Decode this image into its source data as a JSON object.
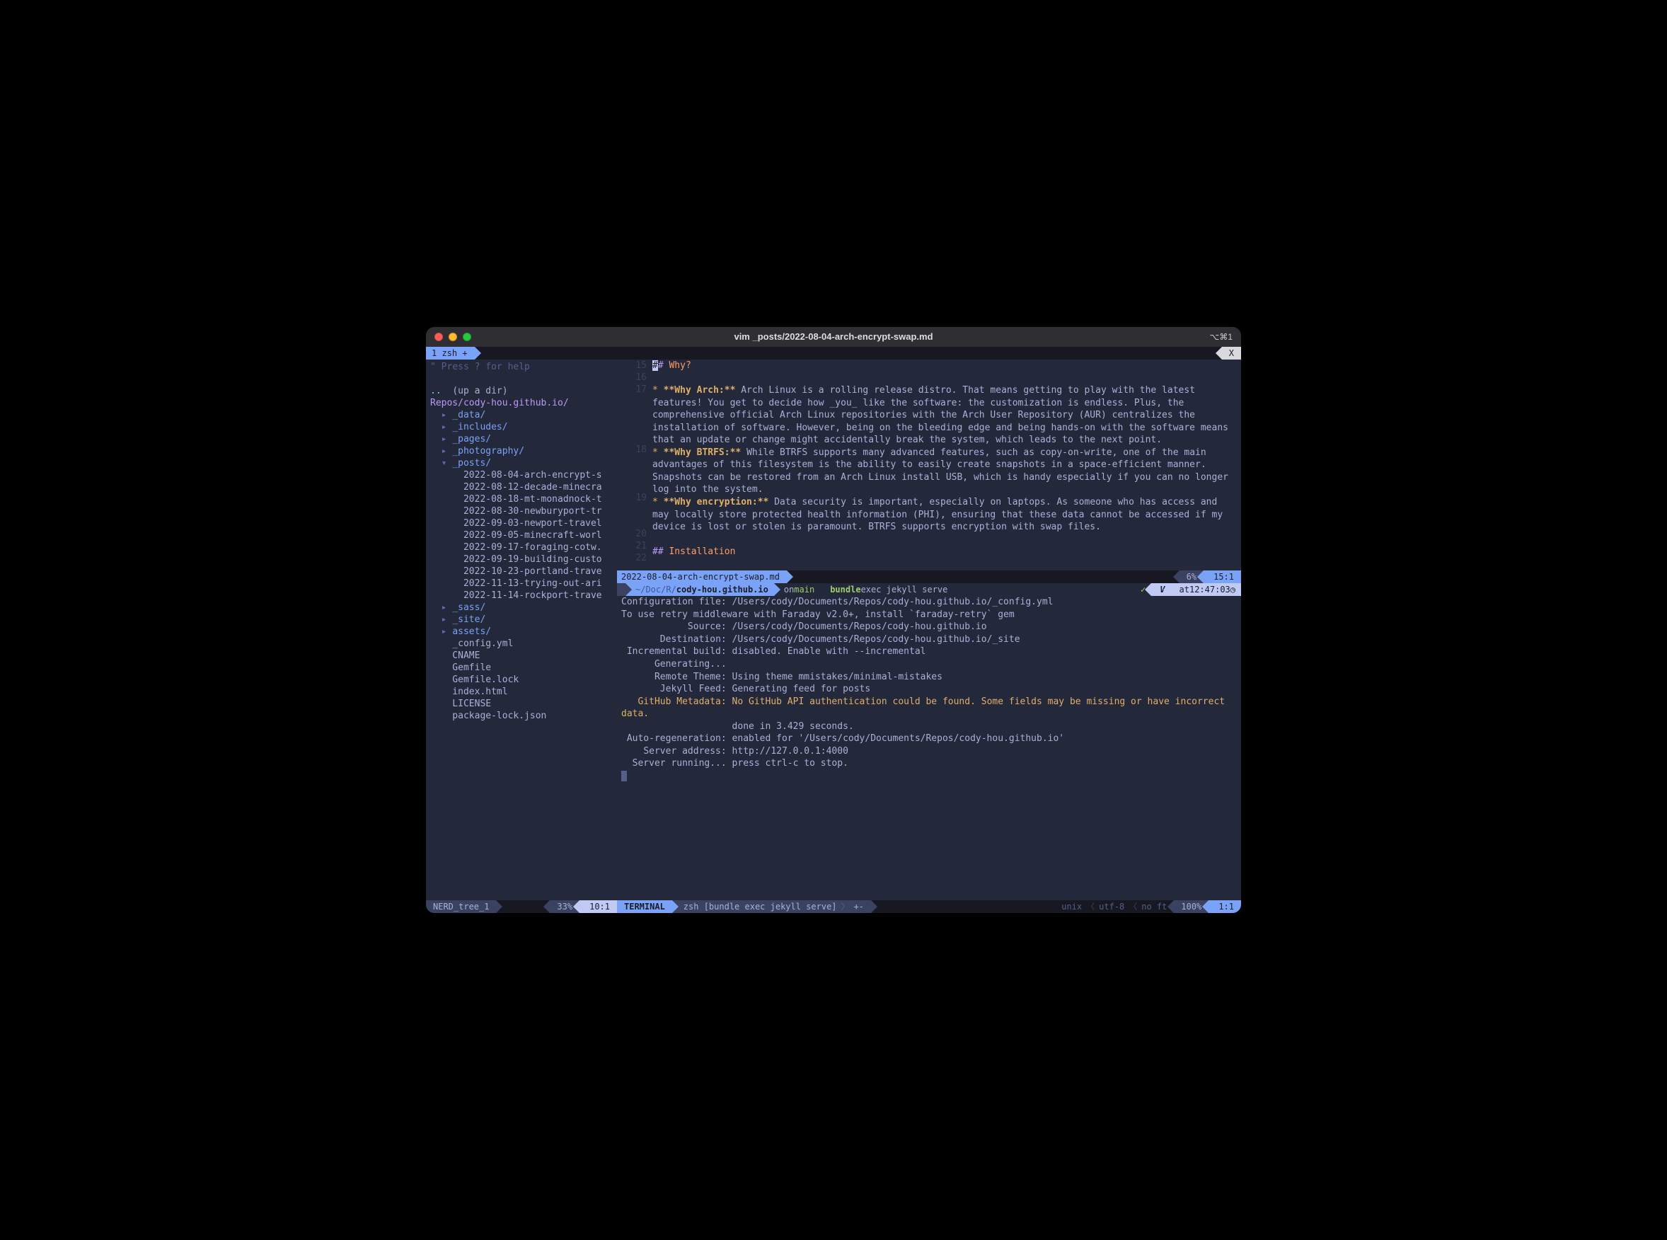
{
  "titlebar": {
    "title": "vim _posts/2022-08-04-arch-encrypt-swap.md",
    "shortcut": "⌥⌘1"
  },
  "tmux_tab": {
    "label": "1 zsh +",
    "close": "X"
  },
  "nerdtree": {
    "help": "\" Press ? for help",
    "up_dotdot": "..",
    "up_label": "(up a dir)",
    "root_marker": "</",
    "root_path": "Repos/cody-hou.github.io/",
    "folders_closed": [
      "_data/",
      "_includes/",
      "_pages/",
      "_photography/"
    ],
    "folder_open": "_posts/",
    "posts": [
      "2022-08-04-arch-encrypt-s",
      "2022-08-12-decade-minecra",
      "2022-08-18-mt-monadnock-t",
      "2022-08-30-newburyport-tr",
      "2022-09-03-newport-travel",
      "2022-09-05-minecraft-worl",
      "2022-09-17-foraging-cotw.",
      "2022-09-19-building-custo",
      "2022-10-23-portland-trave",
      "2022-11-13-trying-out-ari",
      "2022-11-14-rockport-trave"
    ],
    "folders_after": [
      "_sass/",
      "_site/",
      "assets/"
    ],
    "files": [
      "_config.yml",
      "CNAME",
      "Gemfile",
      "Gemfile.lock",
      "index.html",
      "LICENSE",
      "package-lock.json"
    ]
  },
  "editor": {
    "gutter_start": 15,
    "lines": [
      {
        "n": 15,
        "pre": "## ",
        "kw": "Why?"
      },
      {
        "n": 16,
        "text": ""
      },
      {
        "n": 17,
        "star": "*",
        "bold": " **Why Arch:** ",
        "text": "Arch Linux is a rolling release distro. That means getting to play with the latest features! You get to decide how _you_ like the software: the customization is endless. Plus, the comprehensive official Arch Linux repositories with the Arch User Repository (AUR) centralizes the installation of software. However, being on the bleeding edge and being hands-on with the software means that an update or change might accidentally break the system, which leads to the next point."
      },
      {
        "n": 18,
        "star": "*",
        "bold": " **Why BTRFS:** ",
        "text": "While BTRFS supports many advanced features, such as copy-on-write, one of the main advantages of this filesystem is the ability to easily create snapshots in a space-efficient manner. Snapshots can be restored from an Arch Linux install USB, which is handy especially if you can no longer log into the system."
      },
      {
        "n": 19,
        "star": "*",
        "bold": " **Why encryption:** ",
        "text": "Data security is important, especially on laptops. As someone who has access and may locally store protected health information (PHI), ensuring that these data cannot be accessed if my device is lost or stolen is paramount. BTRFS supports encryption with swap files."
      },
      {
        "n": 20,
        "text": ""
      },
      {
        "n": 21,
        "pre": "## ",
        "kw": "Installation"
      },
      {
        "n": 22,
        "text": ""
      }
    ],
    "bufferline": {
      "name": "2022-08-04-arch-encrypt-swap.md",
      "pct": "6%",
      "pos": "15:1"
    }
  },
  "prompt": {
    "icon": "",
    "path_dim": "~/Doc/R/",
    "path_bold": "cody-hou.github.io",
    "on": " on ",
    "branch_icon": " ",
    "branch": "main",
    "cmd_first": "bundle",
    "cmd_rest": " exec jekyll serve",
    "ok": "✓",
    "mode": "V",
    "at": "at ",
    "time": "12:47:03",
    "clock": " ◷"
  },
  "terminal": [
    "Configuration file: /Users/cody/Documents/Repos/cody-hou.github.io/_config.yml",
    "To use retry middleware with Faraday v2.0+, install `faraday-retry` gem",
    "            Source: /Users/cody/Documents/Repos/cody-hou.github.io",
    "       Destination: /Users/cody/Documents/Repos/cody-hou.github.io/_site",
    " Incremental build: disabled. Enable with --incremental",
    "      Generating...",
    "      Remote Theme: Using theme mmistakes/minimal-mistakes",
    "       Jekyll Feed: Generating feed for posts"
  ],
  "terminal_warn": "   GitHub Metadata: No GitHub API authentication could be found. Some fields may be missing or have incorrect data.",
  "terminal_after": [
    "                    done in 3.429 seconds.",
    " Auto-regeneration: enabled for '/Users/cody/Documents/Repos/cody-hou.github.io'",
    "    Server address: http://127.0.0.1:4000",
    "  Server running... press ctrl-c to stop."
  ],
  "status_left": {
    "name": "NERD_tree_1",
    "pct": "33%",
    "pos": "10:1"
  },
  "status_right": {
    "mode": "TERMINAL",
    "title": "zsh [bundle exec jekyll serve]",
    "mod": "+-",
    "enc": "unix",
    "sep1": "❬",
    "enc2": "utf-8",
    "ft": "no ft",
    "pct": "100%",
    "pos": "1:1"
  }
}
